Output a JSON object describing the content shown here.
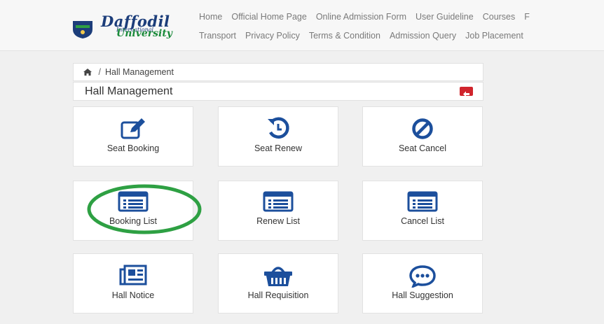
{
  "header": {
    "logo": {
      "brand_line1": "Daffodil",
      "brand_line_small": "International",
      "brand_line2": "University"
    },
    "nav_row1": [
      "Home",
      "Official Home Page",
      "Online Admission Form",
      "User Guideline",
      "Courses",
      "F"
    ],
    "nav_row2": [
      "Transport",
      "Privacy Policy",
      "Terms & Condition",
      "Admission Query",
      "Job Placement"
    ]
  },
  "breadcrumb": {
    "home_icon": "home-icon",
    "separator": "/",
    "current": "Hall Management"
  },
  "panel": {
    "title": "Hall Management",
    "back_icon": "arrow-left-icon",
    "back_color": "#d0242c"
  },
  "tiles": [
    {
      "label": "Seat Booking",
      "icon": "edit-icon"
    },
    {
      "label": "Seat Renew",
      "icon": "renew-icon"
    },
    {
      "label": "Seat Cancel",
      "icon": "ban-icon"
    },
    {
      "label": "Booking List",
      "icon": "list-icon"
    },
    {
      "label": "Renew List",
      "icon": "list-icon"
    },
    {
      "label": "Cancel List",
      "icon": "list-icon"
    },
    {
      "label": "Hall Notice",
      "icon": "newspaper-icon"
    },
    {
      "label": "Hall Requisition",
      "icon": "basket-icon"
    },
    {
      "label": "Hall Suggestion",
      "icon": "comment-icon"
    }
  ],
  "colors": {
    "icon": "#1c4f9c",
    "highlight_circle": "#2ea043",
    "accent_red": "#d0242c"
  }
}
